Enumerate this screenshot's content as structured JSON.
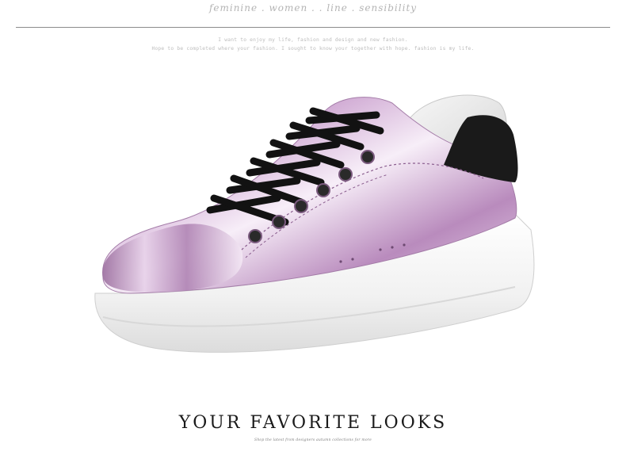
{
  "header": {
    "script_title": "feminine . women . . line . sensibility",
    "tagline_line1": "I want to enjoy my life, fashion and design and new fashion.",
    "tagline_line2": "Hope to be completed where your fashion. I sought to know your together with hope. fashion is my life."
  },
  "product": {
    "image_icon": "metallic-pink-platform-sneaker",
    "colors": {
      "upper": "#d9b8dc",
      "laces": "#121212",
      "heel_tab": "#1a1a1a",
      "sole": "#f4f4f4"
    }
  },
  "footer": {
    "headline": "YOUR FAVORITE LOOKS",
    "subline": "Shop the latest from designers autumn collections for more"
  }
}
